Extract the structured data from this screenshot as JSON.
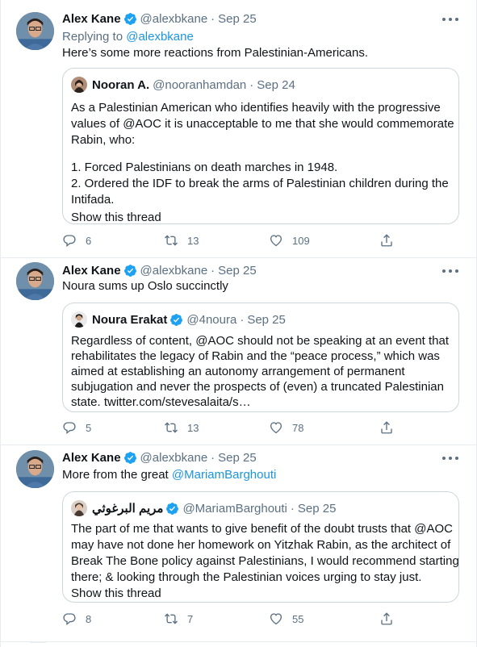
{
  "tweets": [
    {
      "author": {
        "name": "Alex Kane",
        "handle": "@alexbkane",
        "date": "Sep 25"
      },
      "reply": {
        "prefix": "Replying to ",
        "target": "@alexbkane"
      },
      "text": "Here’s some more reactions from Palestinian-Americans.",
      "quote": {
        "author": {
          "name": "Nooran A.",
          "handle": "@nooranhamdan",
          "date": "Sep 24"
        },
        "lines": [
          "As a Palestinian American who identifies heavily with the progressive",
          "values of @AOC it is unacceptable to me that she would commemorate",
          "Rabin, who:",
          "",
          "1. Forced Palestinians on death marches in 1948.",
          "2. Ordered the IDF to break the arms of Palestinian children during the",
          "Intifada."
        ],
        "show_thread": "Show this thread"
      },
      "stats": {
        "replies": "6",
        "retweets": "13",
        "likes": "109"
      }
    },
    {
      "author": {
        "name": "Alex Kane",
        "handle": "@alexbkane",
        "date": "Sep 25"
      },
      "text": "Noura sums up Oslo succinctly",
      "quote": {
        "author": {
          "name": "Noura Erakat",
          "handle": "@4noura",
          "date": "Sep 25"
        },
        "lines": [
          "Regardless of content, @AOC should not be speaking at an event that",
          "rehabilitates the legacy of Rabin and the “peace process,” which was",
          "aimed at establishing an autonomy arrangement of permanent",
          "subjugation and never the prospects of (even) a truncated Palestinian",
          "state. twitter.com/stevesalaita/s…"
        ]
      },
      "stats": {
        "replies": "5",
        "retweets": "13",
        "likes": "78"
      }
    },
    {
      "author": {
        "name": "Alex Kane",
        "handle": "@alexbkane",
        "date": "Sep 25"
      },
      "text_prefix": "More from the great ",
      "text_mention": "@MariamBarghouti",
      "quote": {
        "author": {
          "name": "مريم البرغوثي",
          "handle": "@MariamBarghouti",
          "date": "Sep 25"
        },
        "lines": [
          "The part of me that wants to give benefit of the doubt trusts that @AOC",
          "may have not done her homework on Yitzhak Rabin, as the architect of",
          "Break The Bone policy against Palestinians, I would recommend starting",
          "there; & looking through the Palestinian voices urging to stay just."
        ],
        "show_thread": "Show this thread"
      },
      "stats": {
        "replies": "8",
        "retweets": "7",
        "likes": "55"
      }
    }
  ],
  "icons": {
    "verified": "verified-badge-icon",
    "reply": "reply-icon",
    "retweet": "retweet-icon",
    "like": "heart-icon",
    "share": "share-icon",
    "more": "more-icon"
  },
  "colors": {
    "text": "#0f1419",
    "muted": "#5b7083",
    "link": "#1b95e0",
    "verified": "#1da1f2",
    "border": "#ccd6dd",
    "divider": "#e6ecf0"
  }
}
